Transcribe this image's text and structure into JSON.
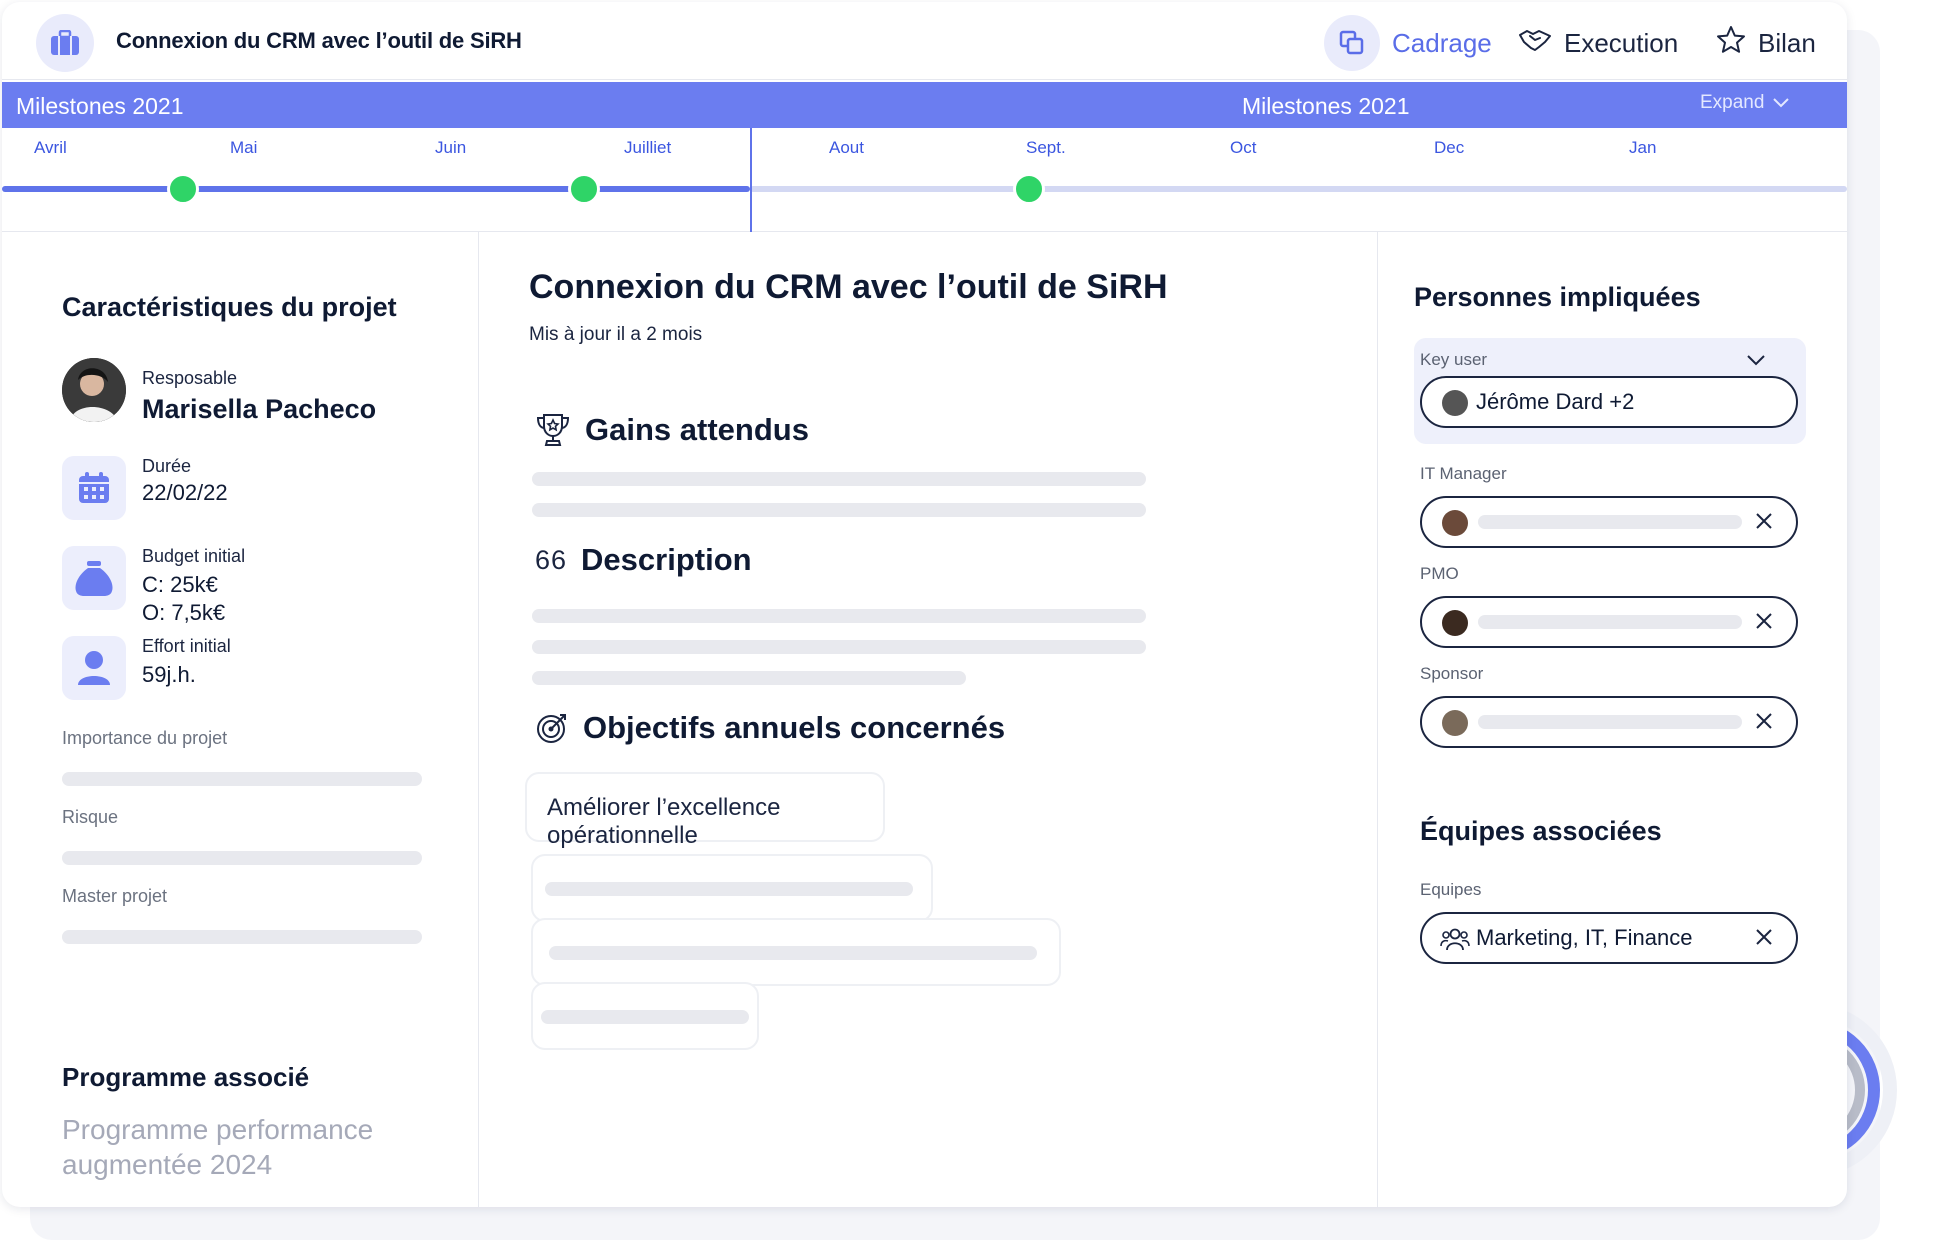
{
  "header": {
    "title": "Connexion du CRM avec l’outil de SiRH",
    "nav": [
      {
        "label": "Cadrage",
        "icon": "copy-icon",
        "active": true
      },
      {
        "label": "Execution",
        "icon": "handshake-icon",
        "active": false
      },
      {
        "label": "Bilan",
        "icon": "star-icon",
        "active": false
      }
    ]
  },
  "milestones": {
    "left_label": "Milestones 2021",
    "center_label": "Milestones 2021",
    "expand_label": "Expand",
    "months": [
      "Avril",
      "Mai",
      "Juin",
      "Juilliet",
      "Aout",
      "Sept.",
      "Oct",
      "Dec",
      "Jan"
    ]
  },
  "left": {
    "heading": "Caractéristiques du projet",
    "responsable_label": "Resposable",
    "responsable_name": "Marisella Pacheco",
    "duree_label": "Durée",
    "duree_value": "22/02/22",
    "budget_label": "Budget initial",
    "budget_c": "C: 25k€",
    "budget_o": "O: 7,5k€",
    "effort_label": "Effort initial",
    "effort_value": "59j.h.",
    "importance_label": "Importance du projet",
    "risque_label": "Risque",
    "master_label": "Master projet",
    "programme_heading": "Programme associé",
    "programme_value": "Programme performance augmentée 2024"
  },
  "center": {
    "title": "Connexion du CRM avec l’outil de SiRH",
    "updated": "Mis à jour il a 2 mois",
    "gains_heading": "Gains attendus",
    "description_quote": "66",
    "description_heading": "Description",
    "objectifs_heading": "Objectifs annuels concernés",
    "objectif_1": "Améliorer l’excellence opérationnelle"
  },
  "right": {
    "heading": "Personnes impliquées",
    "key_user_label": "Key user",
    "key_user_value": "Jérôme Dard +2",
    "it_manager_label": "IT Manager",
    "pmo_label": "PMO",
    "sponsor_label": "Sponsor",
    "equipes_heading": "Équipes associées",
    "equipes_label": "Equipes",
    "equipes_value": "Marketing, IT, Finance"
  },
  "colors": {
    "accent": "#6b7df0",
    "milestone_done": "#2fd467",
    "timeline_future": "#d3d8f3"
  }
}
